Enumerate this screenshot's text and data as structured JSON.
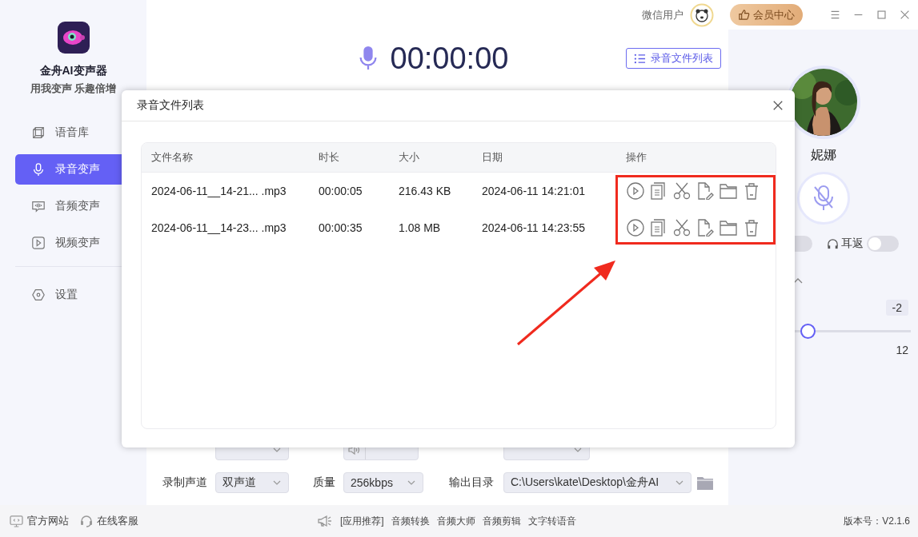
{
  "app": {
    "name": "金舟AI变声器",
    "slogan": "用我变声 乐趣倍增"
  },
  "sidebar": {
    "items": [
      {
        "label": "语音库",
        "kind": "library",
        "selected": false
      },
      {
        "label": "录音变声",
        "kind": "record",
        "selected": true
      },
      {
        "label": "音频变声",
        "kind": "audio",
        "selected": false
      },
      {
        "label": "视频变声",
        "kind": "video",
        "selected": false
      },
      {
        "label": "设置",
        "kind": "settings",
        "selected": false
      }
    ]
  },
  "header": {
    "user": "微信用户",
    "vip_button": "会员中心"
  },
  "recorder": {
    "time": "00:00:00",
    "list_button": "录音文件列表"
  },
  "settings": [
    {
      "kind": "select"
    },
    {
      "kind": "volume"
    },
    {
      "kind": "select"
    },
    {
      "label": "录制声道",
      "value": "双声道",
      "kind": "select"
    },
    {
      "label": "质量",
      "value": "256kbps",
      "kind": "select"
    },
    {
      "label": "输出目录",
      "value": "C:\\Users\\kate\\Desktop\\金舟AI",
      "kind": "path"
    }
  ],
  "voice": {
    "name": "妮娜",
    "muted": true
  },
  "toggles": [
    {
      "on": false
    },
    {
      "label": "耳返",
      "on": false
    }
  ],
  "pitch": {
    "reading": "-2",
    "max_label": "12",
    "level": 0.42
  },
  "dialog": {
    "title": "录音文件列表",
    "columns": [
      "文件名称",
      "时长",
      "大小",
      "日期",
      "操作"
    ],
    "rows": [
      {
        "name": "2024-06-11__14-21... .mp3",
        "duration": "00:00:05",
        "size": "216.43 KB",
        "date": "2024-06-11 14:21:01"
      },
      {
        "name": "2024-06-11__14-23... .mp3",
        "duration": "00:00:35",
        "size": "1.08 MB",
        "date": "2024-06-11 14:23:55"
      }
    ]
  },
  "footer": {
    "links": [
      {
        "label": "官方网站",
        "kind": "web"
      },
      {
        "label": "在线客服",
        "kind": "support"
      }
    ],
    "promo": [
      "[应用推荐]",
      "音频转换",
      "音频大师",
      "音频剪辑",
      "文字转语音"
    ],
    "version": "版本号：V2.1.6"
  }
}
